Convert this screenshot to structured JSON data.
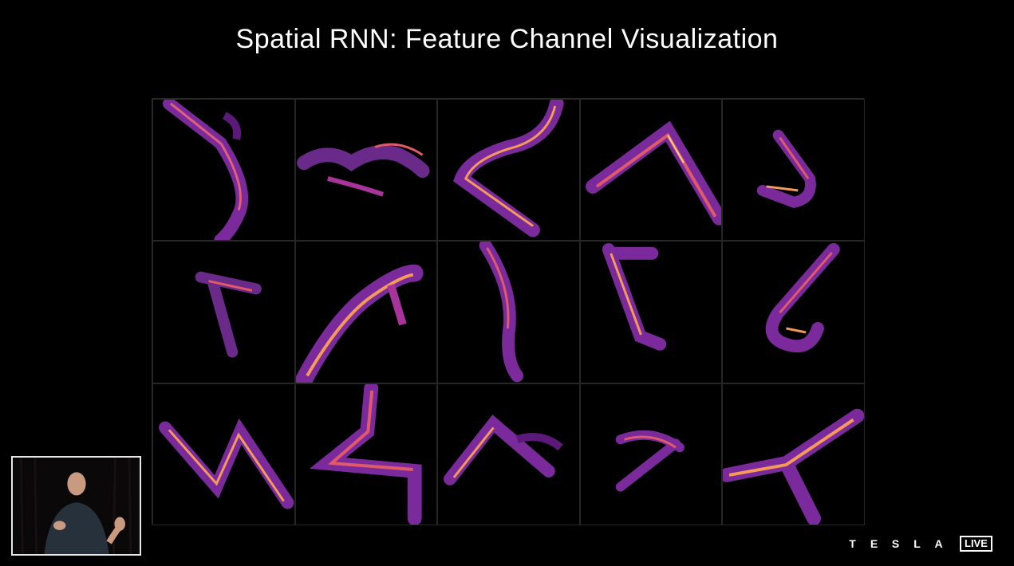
{
  "slide": {
    "title": "Spatial RNN: Feature Channel Visualization",
    "grid_rows": 3,
    "grid_cols": 5,
    "colormap": [
      "#1a0630",
      "#5b1a7a",
      "#a8339a",
      "#e05a6a",
      "#f59a5a",
      "#fcd58a"
    ]
  },
  "brand": {
    "letters": [
      "T",
      "E",
      "S",
      "L",
      "A"
    ],
    "live_label": "LIVE"
  },
  "presenter_video": {
    "icon": "presenter-pip-video"
  }
}
